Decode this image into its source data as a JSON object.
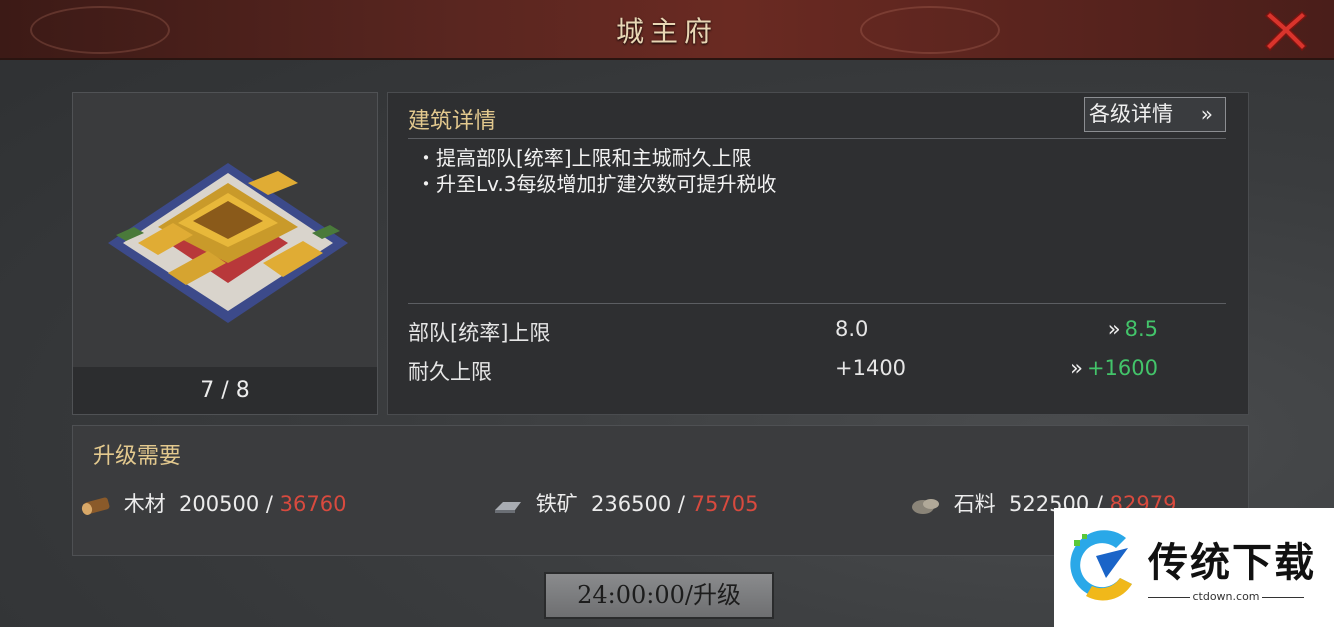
{
  "window": {
    "title": "城主府",
    "close_icon": "close-x-icon"
  },
  "building": {
    "level": "7 / 8"
  },
  "details": {
    "heading": "建筑详情",
    "levels_button": "各级详情",
    "levels_button_icon": "double-chevron-right-icon",
    "description": [
      "・提高部队[统率]上限和主城耐久上限",
      "・升至Lv.3每级增加扩建次数可提升税收"
    ],
    "stats": [
      {
        "label": "部队[统率]上限",
        "current": "8.0",
        "arrow": "»",
        "next": "8.5"
      },
      {
        "label": "耐久上限",
        "current": "+1400",
        "arrow": "»",
        "next": "+1600"
      }
    ]
  },
  "requirements": {
    "heading": "升级需要",
    "items": [
      {
        "icon": "wood-log-icon",
        "name": "木材",
        "have": "200500 / ",
        "need": "36760"
      },
      {
        "icon": "iron-ore-icon",
        "name": "铁矿",
        "have": "236500 / ",
        "need": "75705"
      },
      {
        "icon": "stone-icon",
        "name": "石料",
        "have": "522500 / ",
        "need": "82979"
      }
    ]
  },
  "upgrade_button": "24:00:00/升级",
  "watermark": {
    "text": "传统下载",
    "url": "ctdown.com"
  },
  "colors": {
    "accent_gold": "#e3c98e",
    "increase_green": "#43c46a",
    "need_red": "#d84a3e",
    "close_red": "#d9342c"
  }
}
